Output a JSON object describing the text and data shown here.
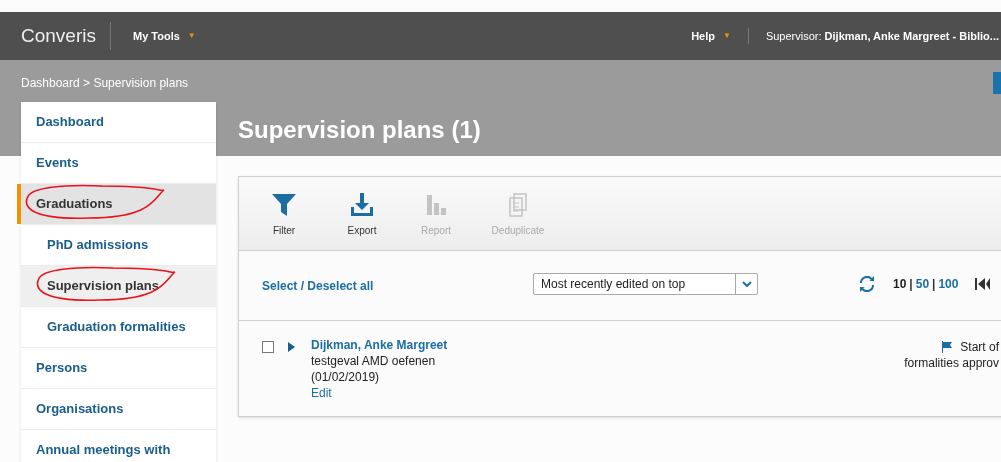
{
  "top_bar": {
    "logo": "Converis",
    "menus": [
      {
        "label": "My Tools",
        "caret": "▼"
      }
    ],
    "help": {
      "label": "Help",
      "caret": "▼"
    },
    "user": {
      "prefix": "Supervisor: ",
      "name": "Dijkman, Anke Margreet - Biblio..."
    }
  },
  "breadcrumb": "Dashboard > Supervision plans",
  "page_title": "Supervision plans (1)",
  "sidebar": {
    "items": [
      {
        "label": "Dashboard",
        "selected": false,
        "annotated": false
      },
      {
        "label": "Events",
        "selected": false,
        "annotated": false
      },
      {
        "label": "Graduations",
        "selected": true,
        "annotated": true,
        "children": [
          {
            "label": "PhD admissions",
            "selected": false,
            "annotated": false
          },
          {
            "label": "Supervision plans",
            "selected": true,
            "annotated": true
          },
          {
            "label": "Graduation formalities",
            "selected": false,
            "annotated": false
          }
        ]
      },
      {
        "label": "Persons",
        "selected": false,
        "annotated": false
      },
      {
        "label": "Organisations",
        "selected": false,
        "annotated": false
      },
      {
        "label": "Annual meetings with",
        "selected": false,
        "annotated": false
      }
    ]
  },
  "toolbar": [
    {
      "kind": "filter",
      "label": "Filter",
      "disabled": false
    },
    {
      "kind": "export",
      "label": "Export",
      "disabled": false
    },
    {
      "kind": "report",
      "label": "Report",
      "disabled": true
    },
    {
      "kind": "deduplicate",
      "label": "Deduplicate",
      "disabled": true
    }
  ],
  "list_controls": {
    "select_all": "Select / Deselect all",
    "sort": {
      "value": "Most recently edited on top"
    },
    "page_size_separator": "|",
    "page_sizes": [
      {
        "label": "10",
        "selected": true
      },
      {
        "label": "50",
        "selected": false
      },
      {
        "label": "100",
        "selected": false
      }
    ]
  },
  "rows": [
    {
      "checked": false,
      "name": "Dijkman, Anke Margreet",
      "lines": [
        "testgeval AMD oefenen",
        "(01/02/2019)"
      ],
      "action": "Edit",
      "status": [
        "Start of",
        "formalities approv"
      ]
    }
  ]
}
